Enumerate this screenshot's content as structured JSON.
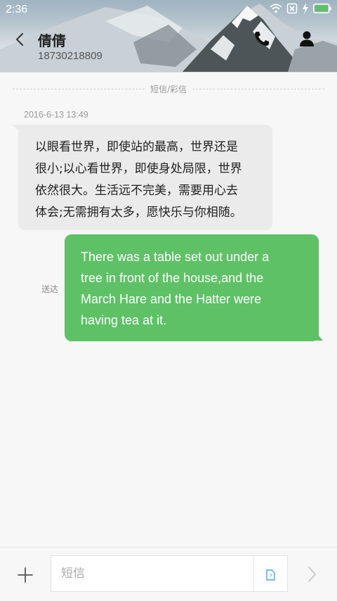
{
  "status_bar": {
    "time": "2:36",
    "icons": [
      "wifi-icon",
      "sim-blocked-icon",
      "charging-icon",
      "battery-icon"
    ]
  },
  "header": {
    "contact_name": "倩倩",
    "contact_number": "18730218809",
    "icons": [
      "back-icon",
      "phone-icon",
      "profile-icon"
    ]
  },
  "conversation": {
    "divider_label": "短信/彩信",
    "timestamp": "2016-6-13 13:49",
    "incoming_lines": [
      "以眼看世界，即使站的最高，世界还是",
      "很小;以心看世界，即使身处局限，世界",
      "依然很大。生活远不完美，需要用心去",
      "体会;无需拥有太多，愿快乐与你相随。"
    ],
    "outgoing_lines": [
      "There was a table set out under a",
      "tree in front of the house,and the",
      "March Hare and the Hatter were",
      "having tea at it."
    ],
    "sent_status": "送达"
  },
  "composer": {
    "placeholder": "短信",
    "value": "",
    "icons": [
      "add-icon",
      "sim-card-icon",
      "send-icon"
    ]
  },
  "colors": {
    "outgoing_bubble": "#5ec166",
    "incoming_bubble": "#ebebeb",
    "background": "#f7f7f7"
  }
}
